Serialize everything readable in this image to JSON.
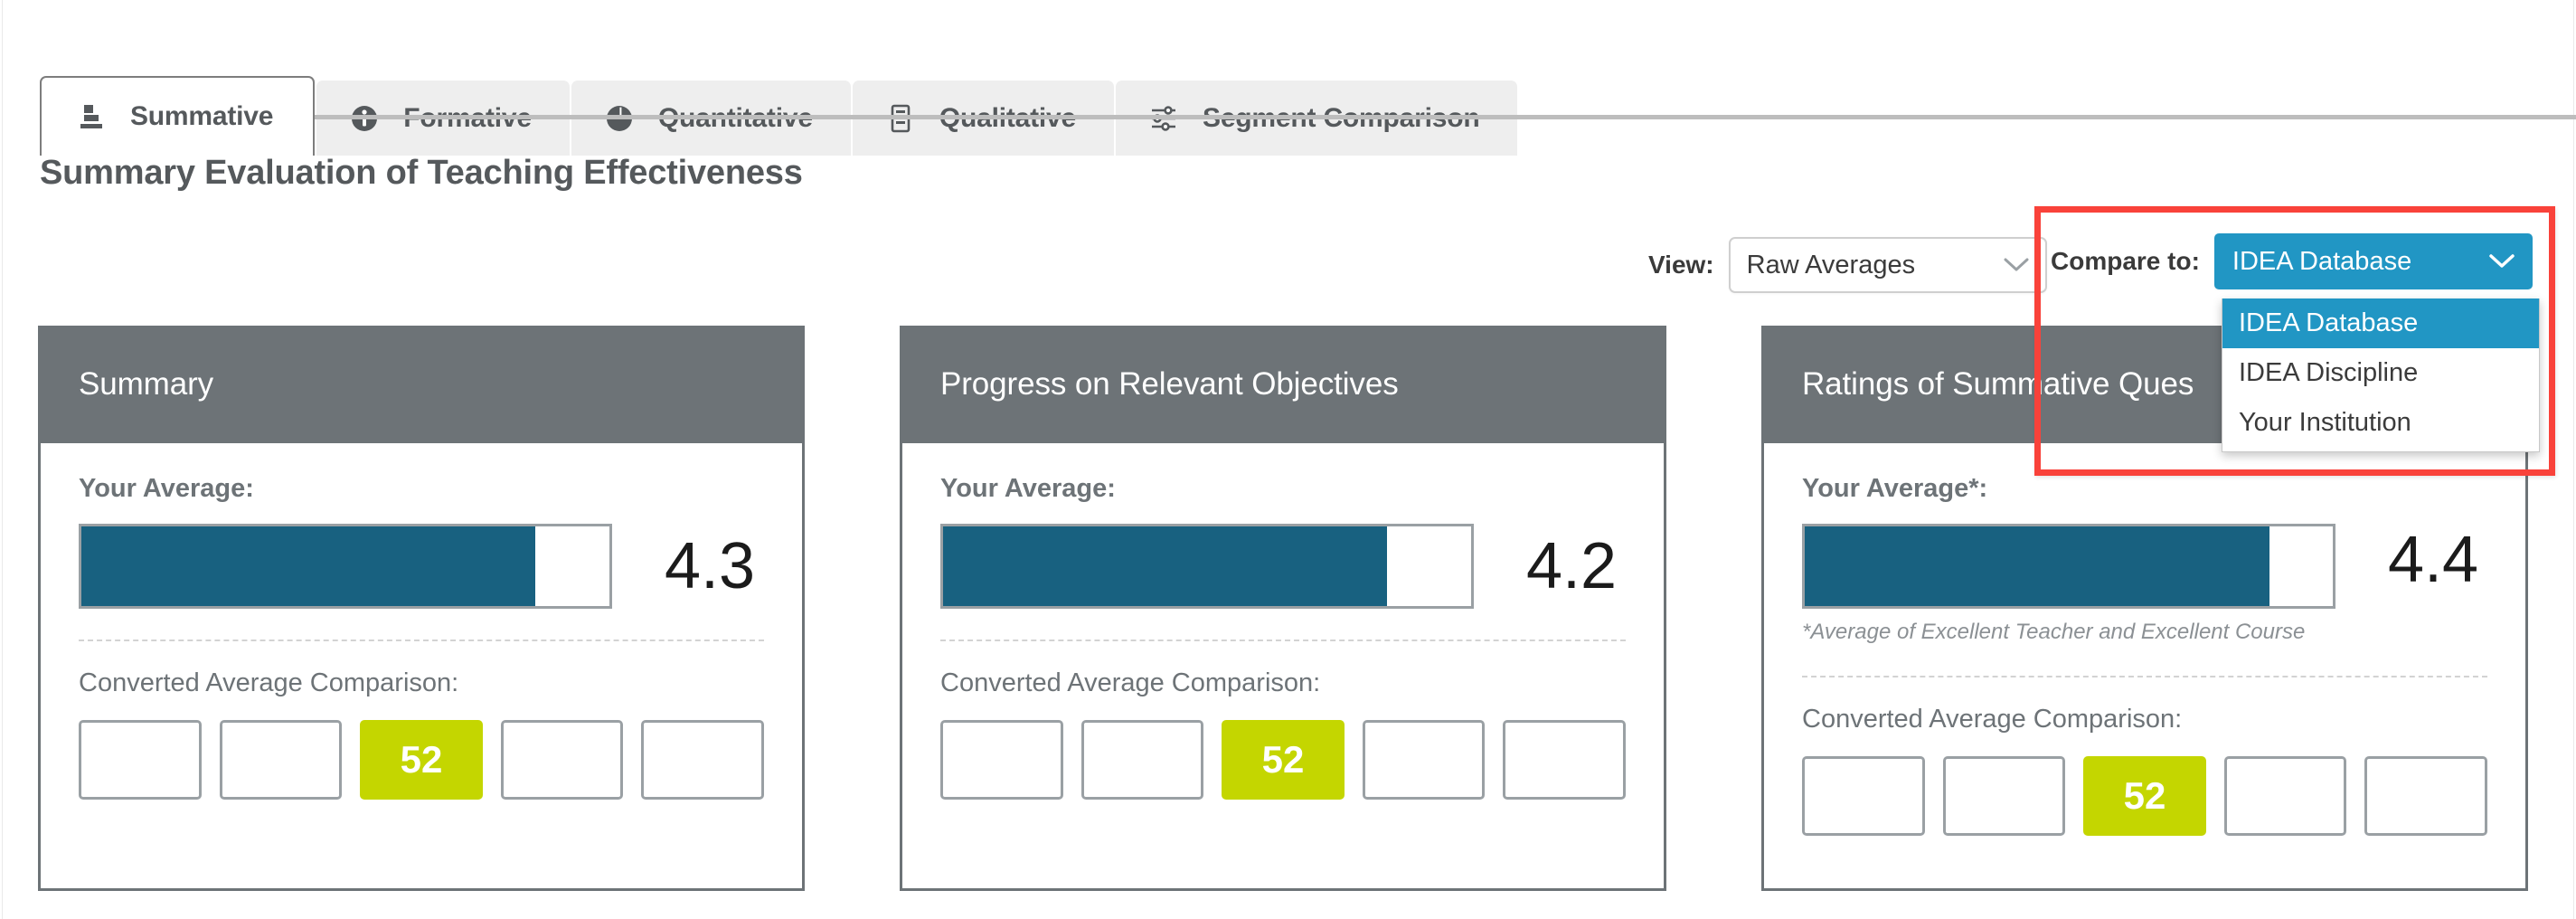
{
  "tabs": [
    {
      "label": "Summative",
      "icon": "bar-chart-icon",
      "active": true
    },
    {
      "label": "Formative",
      "icon": "info-circle-icon",
      "active": false
    },
    {
      "label": "Quantitative",
      "icon": "pie-chart-icon",
      "active": false
    },
    {
      "label": "Qualitative",
      "icon": "document-icon",
      "active": false
    },
    {
      "label": "Segment Comparison",
      "icon": "sliders-icon",
      "active": false
    }
  ],
  "page": {
    "title": "Summary Evaluation of Teaching Effectiveness"
  },
  "controls": {
    "view": {
      "label": "View:",
      "value": "Raw Averages",
      "chevron": "chevron-down-icon"
    },
    "compare": {
      "label": "Compare to:",
      "value": "IDEA Database",
      "chevron": "chevron-down-icon",
      "expanded": true,
      "options": [
        {
          "label": "IDEA Database",
          "selected": true
        },
        {
          "label": "IDEA Discipline",
          "selected": false
        },
        {
          "label": "Your Institution",
          "selected": false
        }
      ]
    }
  },
  "highlight": {
    "color": "#f9423a",
    "target": "compare-to-dropdown"
  },
  "colors": {
    "bar_fill": "#186180",
    "bar_track_border": "#9aa0a4",
    "card_header": "#6d7377",
    "accent_blue": "#2196c4",
    "highlight_green": "#c4d600",
    "highlight_red": "#f9423a"
  },
  "cards": [
    {
      "title": "Summary",
      "average_label": "Your Average:",
      "average_value": "4.3",
      "bar_fill_percent": 86,
      "note": "",
      "converted_label": "Converted Average Comparison:",
      "converted_boxes": [
        {
          "value": "",
          "highlighted": false
        },
        {
          "value": "",
          "highlighted": false
        },
        {
          "value": "52",
          "highlighted": true
        },
        {
          "value": "",
          "highlighted": false
        },
        {
          "value": "",
          "highlighted": false
        }
      ]
    },
    {
      "title": "Progress on Relevant Objectives",
      "average_label": "Your Average:",
      "average_value": "4.2",
      "bar_fill_percent": 84,
      "note": "",
      "converted_label": "Converted Average Comparison:",
      "converted_boxes": [
        {
          "value": "",
          "highlighted": false
        },
        {
          "value": "",
          "highlighted": false
        },
        {
          "value": "52",
          "highlighted": true
        },
        {
          "value": "",
          "highlighted": false
        },
        {
          "value": "",
          "highlighted": false
        }
      ]
    },
    {
      "title": "Ratings of Summative Ques",
      "average_label": "Your Average*:",
      "average_value": "4.4",
      "bar_fill_percent": 88,
      "note": "*Average of Excellent Teacher and Excellent Course",
      "converted_label": "Converted Average Comparison:",
      "converted_boxes": [
        {
          "value": "",
          "highlighted": false
        },
        {
          "value": "",
          "highlighted": false
        },
        {
          "value": "52",
          "highlighted": true
        },
        {
          "value": "",
          "highlighted": false
        },
        {
          "value": "",
          "highlighted": false
        }
      ]
    }
  ]
}
